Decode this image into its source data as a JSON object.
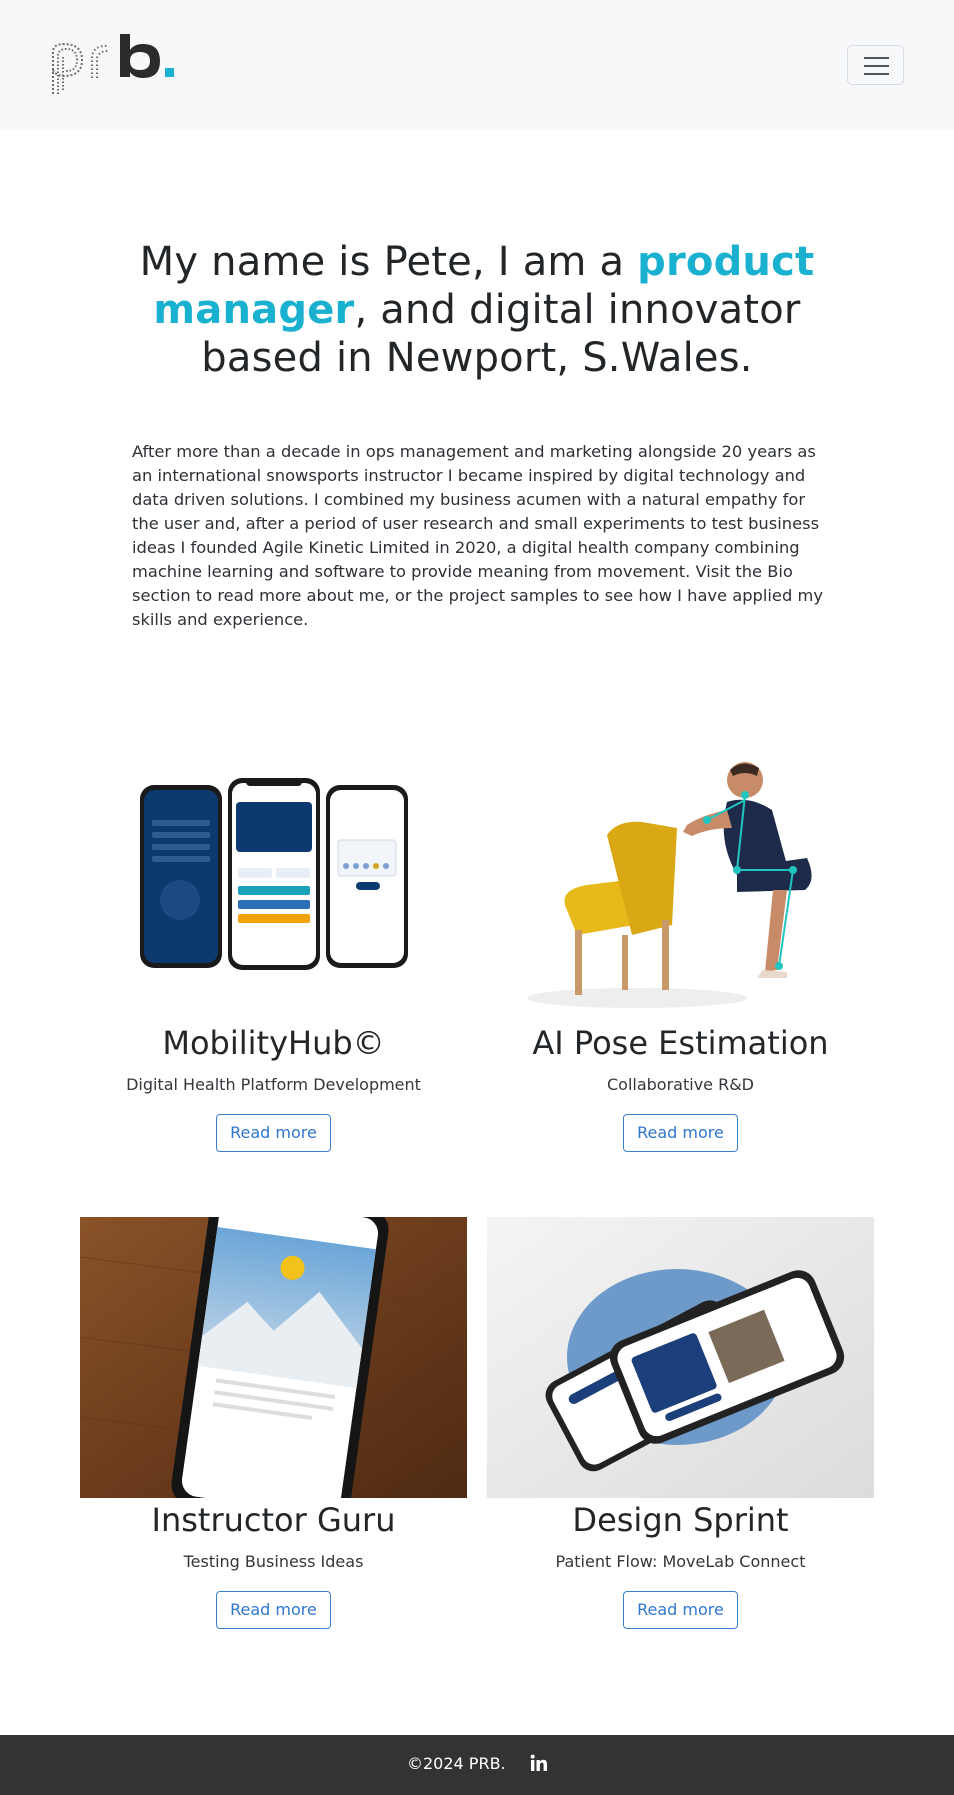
{
  "header": {
    "logo_text": "prb.",
    "colors": {
      "logo_dark": "#2b2b2b",
      "logo_accent": "#1ab0d0"
    }
  },
  "hero": {
    "title_part1": "My name is Pete, I am a ",
    "title_accent": "product manager",
    "title_part2": ", and digital innovator based in Newport, S.Wales.",
    "intro": "After more than a decade in ops management and marketing alongside 20 years as an international snowsports instructor I became inspired by digital technology and data driven solutions. I combined my business acumen with a natural empathy for the user and, after a period of user research and small experiments to test business ideas I founded Agile Kinetic Limited in 2020, a digital health company combining machine learning and software to provide meaning from movement. Visit the Bio section to read more about me, or the project samples to see how I have applied my skills and experience.",
    "accent_color": "#1ab0d0"
  },
  "projects": [
    {
      "title": "MobilityHub©",
      "subtitle": "Digital Health Platform Development",
      "button": "Read more",
      "image": "phones-app-mockup"
    },
    {
      "title": "AI Pose Estimation",
      "subtitle": "Collaborative R&D",
      "button": "Read more",
      "image": "man-squat-pose"
    },
    {
      "title": "Instructor Guru",
      "subtitle": "Testing Business Ideas",
      "button": "Read more",
      "image": "phone-on-wood-table"
    },
    {
      "title": "Design Sprint",
      "subtitle": "Patient Flow: MoveLab Connect",
      "button": "Read more",
      "image": "two-phones-mockup"
    }
  ],
  "footer": {
    "copyright": "©2024 PRB.",
    "social_icon": "linkedin-icon"
  }
}
